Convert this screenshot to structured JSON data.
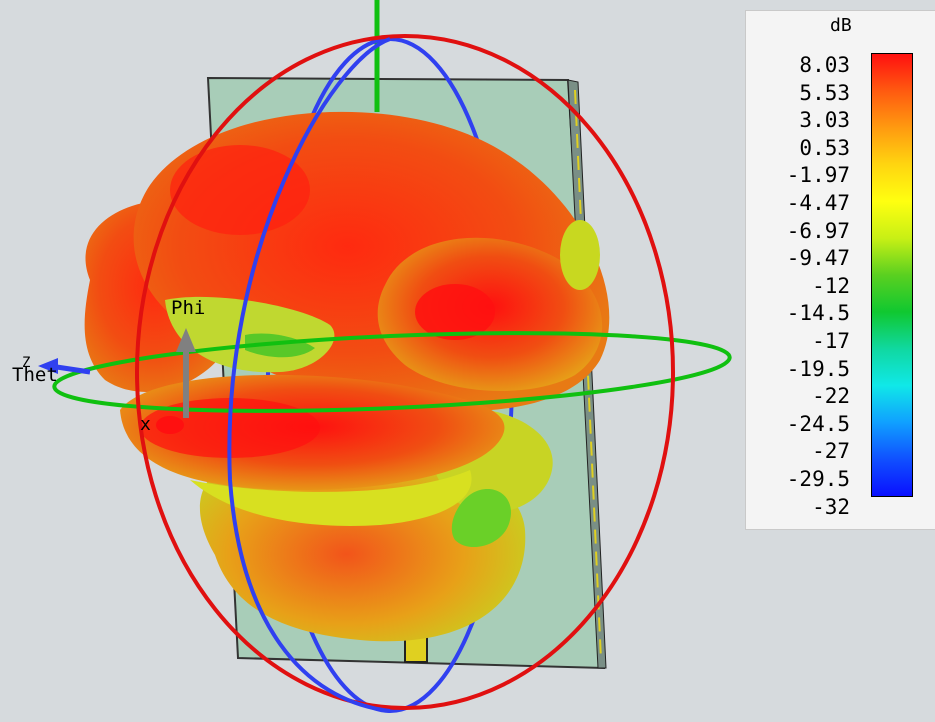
{
  "scene": {
    "axis_labels": {
      "phi": "Phi",
      "theta": "Thet",
      "z": "Z",
      "x": "x"
    },
    "colors": {
      "background": "#d6dadd",
      "board": "#a8cdb8",
      "feed": "#e0d020",
      "phi_circle": "#e01010",
      "theta_circle": "#3040f0",
      "horizon_circle": "#10c010"
    }
  },
  "legend": {
    "unit": "dB",
    "ticks": [
      "8.03",
      "5.53",
      "3.03",
      "0.53",
      "-1.97",
      "-4.47",
      "-6.97",
      "-9.47",
      "-12",
      "-14.5",
      "-17",
      "-19.5",
      "-22",
      "-24.5",
      "-27",
      "-29.5",
      "-32"
    ],
    "colormap": [
      "#ff1010",
      "#ff5a10",
      "#ff9a10",
      "#ffd510",
      "#ffff10",
      "#c8f015",
      "#5ad020",
      "#10c830",
      "#10d8a0",
      "#10e8e8",
      "#10a0ff",
      "#1050ff",
      "#0a10ff"
    ]
  }
}
